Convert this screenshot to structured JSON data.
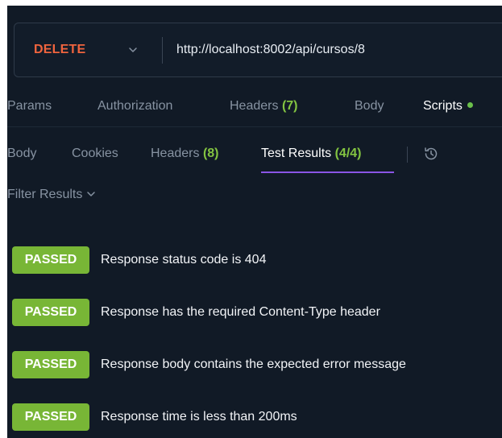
{
  "request": {
    "method": "DELETE",
    "url": "http://localhost:8002/api/cursos/8"
  },
  "request_tabs": [
    {
      "label": "Params"
    },
    {
      "label": "Authorization"
    },
    {
      "label": "Headers",
      "count": "(7)"
    },
    {
      "label": "Body"
    },
    {
      "label": "Scripts",
      "active": true
    }
  ],
  "response_tabs": [
    {
      "label": "Body"
    },
    {
      "label": "Cookies"
    },
    {
      "label": "Headers",
      "count": "(8)"
    },
    {
      "label": "Test Results",
      "count": "(4/4)",
      "active": true
    }
  ],
  "filter": {
    "label": "Filter Results"
  },
  "results": [
    {
      "status": "PASSED",
      "text": "Response status code is 404"
    },
    {
      "status": "PASSED",
      "text": "Response has the required Content-Type header"
    },
    {
      "status": "PASSED",
      "text": "Response body contains the expected error message"
    },
    {
      "status": "PASSED",
      "text": "Response time is less than 200ms"
    }
  ],
  "colors": {
    "background": "#111a26",
    "method": "#f0643e",
    "count": "#83c441",
    "passed_badge": "#78b636",
    "active_underline": "#8a55e5"
  },
  "icons": {
    "method_dropdown": "chevron-down-icon",
    "history": "history-icon",
    "filter": "chevron-down-icon",
    "scripts_indicator": "status-dot-icon"
  }
}
